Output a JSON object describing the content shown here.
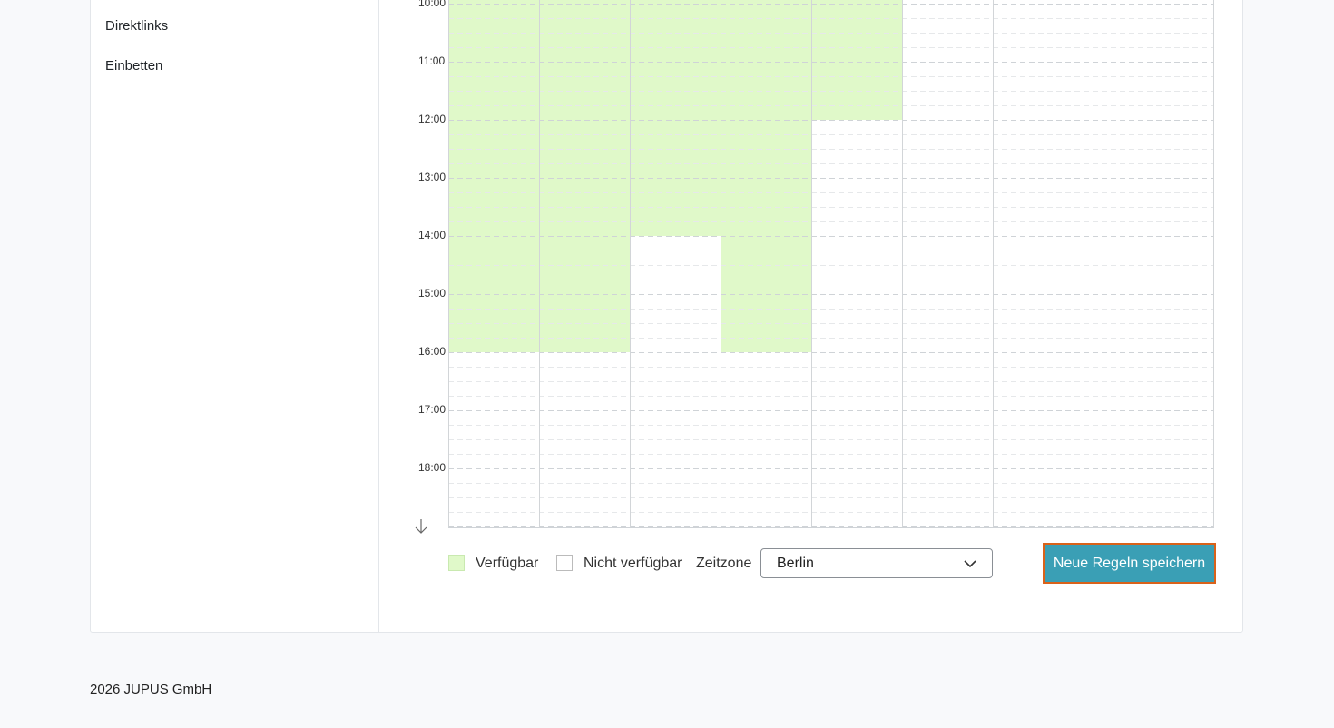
{
  "sidebar": {
    "items": [
      {
        "label": "Direktlinks"
      },
      {
        "label": "Einbetten"
      }
    ]
  },
  "schedule": {
    "hours": [
      "10:00",
      "11:00",
      "12:00",
      "13:00",
      "14:00",
      "15:00",
      "16:00",
      "17:00",
      "18:00"
    ],
    "available_color": "#e0f9c9",
    "columns": [
      {
        "available_until": "16:00"
      },
      {
        "available_until": "16:00"
      },
      {
        "available_until": "14:00"
      },
      {
        "available_until": "16:00"
      },
      {
        "available_until": "12:00"
      },
      {
        "available_until": null
      },
      {
        "available_until": null
      }
    ]
  },
  "legend": {
    "available_label": "Verfügbar",
    "unavailable_label": "Nicht verfügbar",
    "timezone_label": "Zeitzone",
    "timezone_value": "Berlin"
  },
  "actions": {
    "save_label": "Neue Regeln speichern",
    "save_color": "#3a9fb5",
    "save_border_color": "#d9621a"
  },
  "footer": {
    "text": "2026 JUPUS GmbH"
  },
  "icons": {
    "scroll": "arrow-down-icon",
    "dropdown": "chevron-down-icon"
  }
}
